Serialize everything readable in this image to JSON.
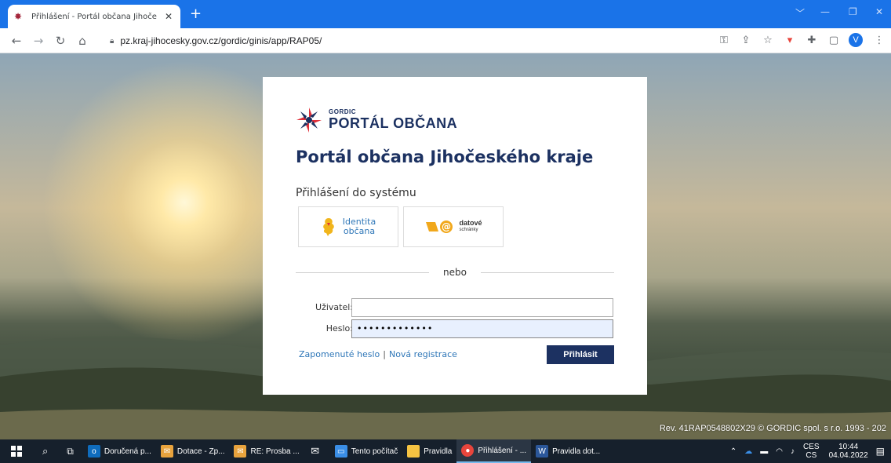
{
  "browser": {
    "tab_title": "Přihlášení - Portál občana Jihoče",
    "tab_close": "✕",
    "new_tab": "+",
    "url": "pz.kraj-jihocesky.gov.cz/gordic/ginis/app/RAP05/",
    "profile_initial": "V"
  },
  "card": {
    "logo_small": "GORDIC",
    "logo_big": "PORTÁL OBČANA",
    "title": "Portál občana Jihočeského kraje",
    "subtitle": "Přihlášení do systému",
    "identita_line1": "Identita",
    "identita_line2": "občana",
    "ds_line1": "datové",
    "ds_line2": "schránky",
    "divider": "nebo",
    "user_label": "Uživatel:",
    "user_value": "",
    "password_label": "Heslo:",
    "password_value": "•••••••••••••",
    "forgot_link": "Zapomenuté heslo",
    "separator": "|",
    "register_link": "Nová registrace",
    "submit_label": "Přihlásit"
  },
  "footer": {
    "revision": "Rev. 41RAP0548802X29 © GORDIC spol. s r.o. 1993 - 202"
  },
  "taskbar": {
    "items": [
      {
        "label": "Doručená p...",
        "icon": "outlook-icon",
        "color": "#0f6cbd"
      },
      {
        "label": "Dotace - Zp...",
        "icon": "mail-icon",
        "color": "#e8a33d"
      },
      {
        "label": "RE: Prosba ...",
        "icon": "mail-icon",
        "color": "#e8a33d"
      },
      {
        "label": "",
        "icon": "envelope-icon",
        "color": "#ffffff"
      },
      {
        "label": "Tento počítač",
        "icon": "computer-icon",
        "color": "#3a8ee6"
      },
      {
        "label": "Pravidla",
        "icon": "folder-icon",
        "color": "#f5c342"
      },
      {
        "label": "Přihlášení - ...",
        "icon": "chrome-icon",
        "color": "#e8453c"
      },
      {
        "label": "Pravidla dot...",
        "icon": "word-icon",
        "color": "#2b579a"
      }
    ],
    "lang_top": "CES",
    "lang_bottom": "CS",
    "time": "10:44",
    "date": "04.04.2022"
  },
  "colors": {
    "brand": "#1c3161",
    "link": "#2f77b8",
    "chrome_blue": "#1a73e8"
  }
}
